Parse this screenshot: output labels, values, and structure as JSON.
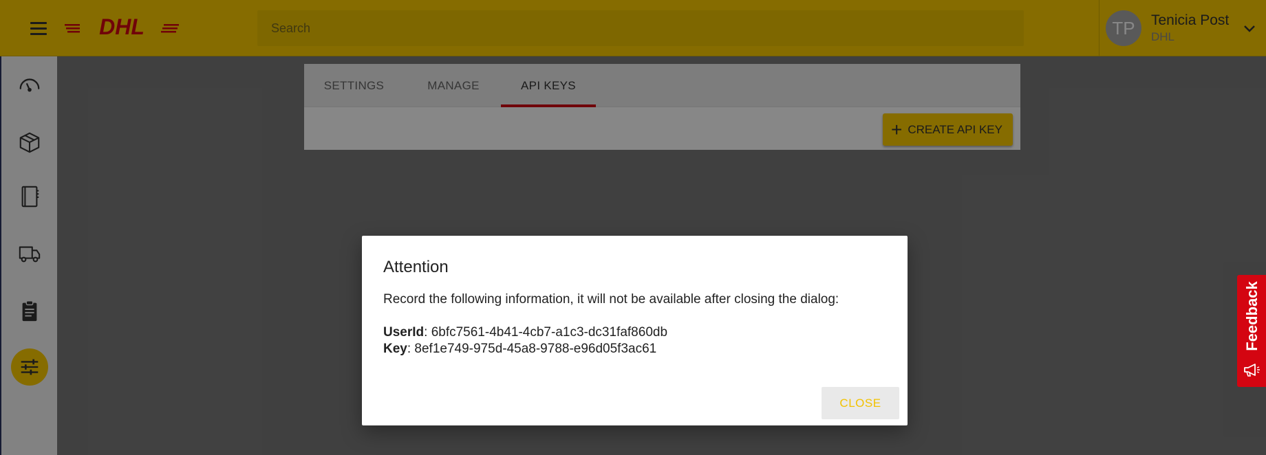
{
  "header": {
    "brand": "DHL",
    "search_placeholder": "Search",
    "user_initials": "TP",
    "user_name": "Tenicia Post",
    "user_org": "DHL"
  },
  "sidebar": {
    "items": [
      {
        "name": "dashboard",
        "icon": "speedometer-icon"
      },
      {
        "name": "shipments",
        "icon": "package-icon"
      },
      {
        "name": "address-book",
        "icon": "notebook-icon"
      },
      {
        "name": "pickups",
        "icon": "truck-icon"
      },
      {
        "name": "reports",
        "icon": "clipboard-icon"
      },
      {
        "name": "settings",
        "icon": "sliders-icon",
        "active": true
      }
    ]
  },
  "tabs": [
    {
      "label": "SETTINGS",
      "active": false
    },
    {
      "label": "MANAGE",
      "active": false
    },
    {
      "label": "API KEYS",
      "active": true
    }
  ],
  "toolbar": {
    "create_label": "CREATE API KEY"
  },
  "feedback": {
    "label": "Feedback"
  },
  "dialog": {
    "title": "Attention",
    "message": "Record the following information, it will not be available after closing the dialog:",
    "user_id_label": "UserId",
    "user_id_value": ": 6bfc7561-4b41-4cb7-a1c3-dc31faf860db",
    "key_label": "Key",
    "key_value": ": 8ef1e749-975d-45a8-9788-e96d05f3ac61",
    "close_label": "CLOSE"
  },
  "colors": {
    "brand_yellow": "#fecc00",
    "brand_red": "#d40511",
    "overlay": "rgba(0,0,0,0.47)"
  }
}
